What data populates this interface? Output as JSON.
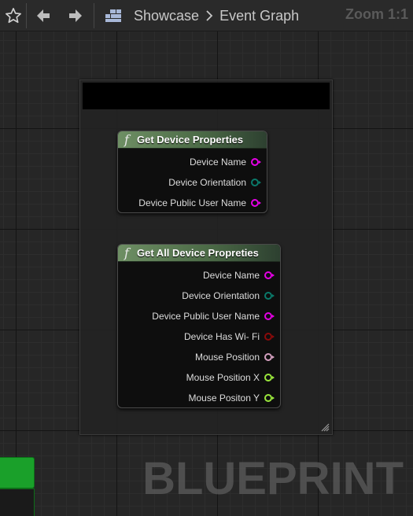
{
  "toolbar": {
    "breadcrumb": [
      "Showcase",
      "Event Graph"
    ],
    "zoom_label": "Zoom 1:1"
  },
  "comment": {
    "title": ""
  },
  "nodes": [
    {
      "title": "Get Device Properties",
      "pins": [
        {
          "label": "Device Name",
          "color": "#e600e6"
        },
        {
          "label": "Device Orientation",
          "color": "#0a7a6a"
        },
        {
          "label": "Device Public User Name",
          "color": "#e600e6"
        }
      ]
    },
    {
      "title": "Get All Device Propreties",
      "pins": [
        {
          "label": "Device Name",
          "color": "#e600e6"
        },
        {
          "label": "Device Orientation",
          "color": "#0a7a6a"
        },
        {
          "label": "Device Public User Name",
          "color": "#e600e6"
        },
        {
          "label": "Device Has Wi- Fi",
          "color": "#8a0a0a"
        },
        {
          "label": "Mouse Position",
          "color": "#d4a0c0"
        },
        {
          "label": "Mouse Position X",
          "color": "#9ae63c"
        },
        {
          "label": "Mouse Positon Y",
          "color": "#9ae63c"
        }
      ]
    }
  ],
  "watermark": "BLUEPRINT",
  "colors": {
    "accent_green": "#1aa02a",
    "header_green": "#6e8f64"
  },
  "icons": [
    "star-icon",
    "back-arrow-icon",
    "forward-arrow-icon",
    "graph-icon",
    "chevron-right-icon",
    "function-icon",
    "resize-grip-icon"
  ]
}
